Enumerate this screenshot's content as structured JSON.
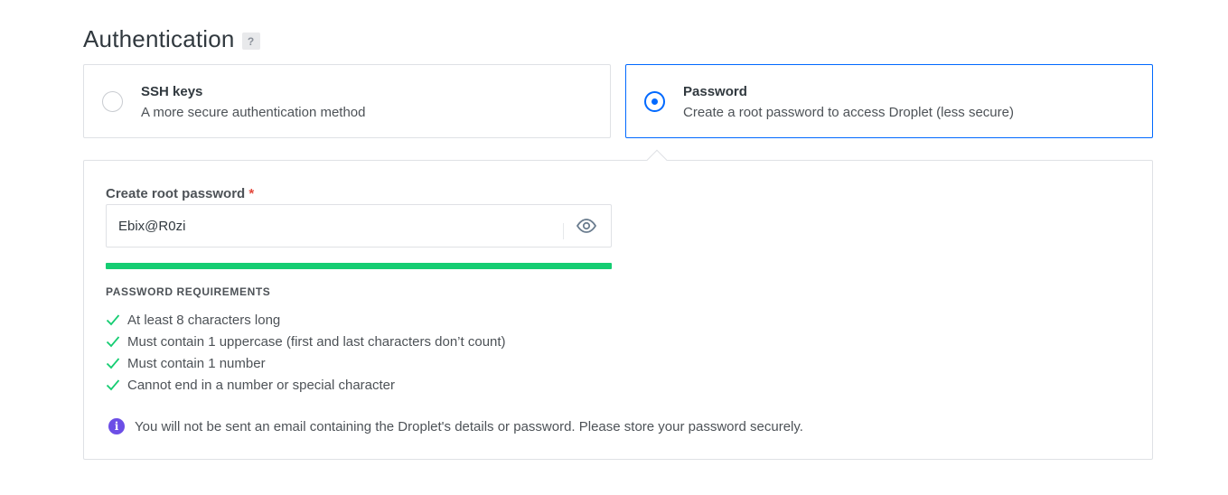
{
  "section": {
    "title": "Authentication",
    "help_label": "?"
  },
  "options": [
    {
      "title": "SSH keys",
      "description": "A more secure authentication method",
      "selected": false
    },
    {
      "title": "Password",
      "description": "Create a root password to access Droplet (less secure)",
      "selected": true
    }
  ],
  "password_panel": {
    "label": "Create root password",
    "required_marker": "*",
    "value": "Ebix@R0zi",
    "reveal_icon": "eye-icon",
    "strength_percent": 100,
    "strength_color": "#15cd72",
    "requirements_heading": "PASSWORD REQUIREMENTS",
    "requirements": [
      "At least 8 characters long",
      "Must contain 1 uppercase (first and last characters don’t count)",
      "Must contain 1 number",
      "Cannot end in a number or special character"
    ],
    "notice_icon": "info-icon",
    "notice": "You will not be sent an email containing the Droplet's details or password. Please store your password securely."
  },
  "colors": {
    "accent": "#0069ff",
    "check": "#15cd72",
    "info": "#6c4ee6",
    "required": "#e44a3e"
  }
}
